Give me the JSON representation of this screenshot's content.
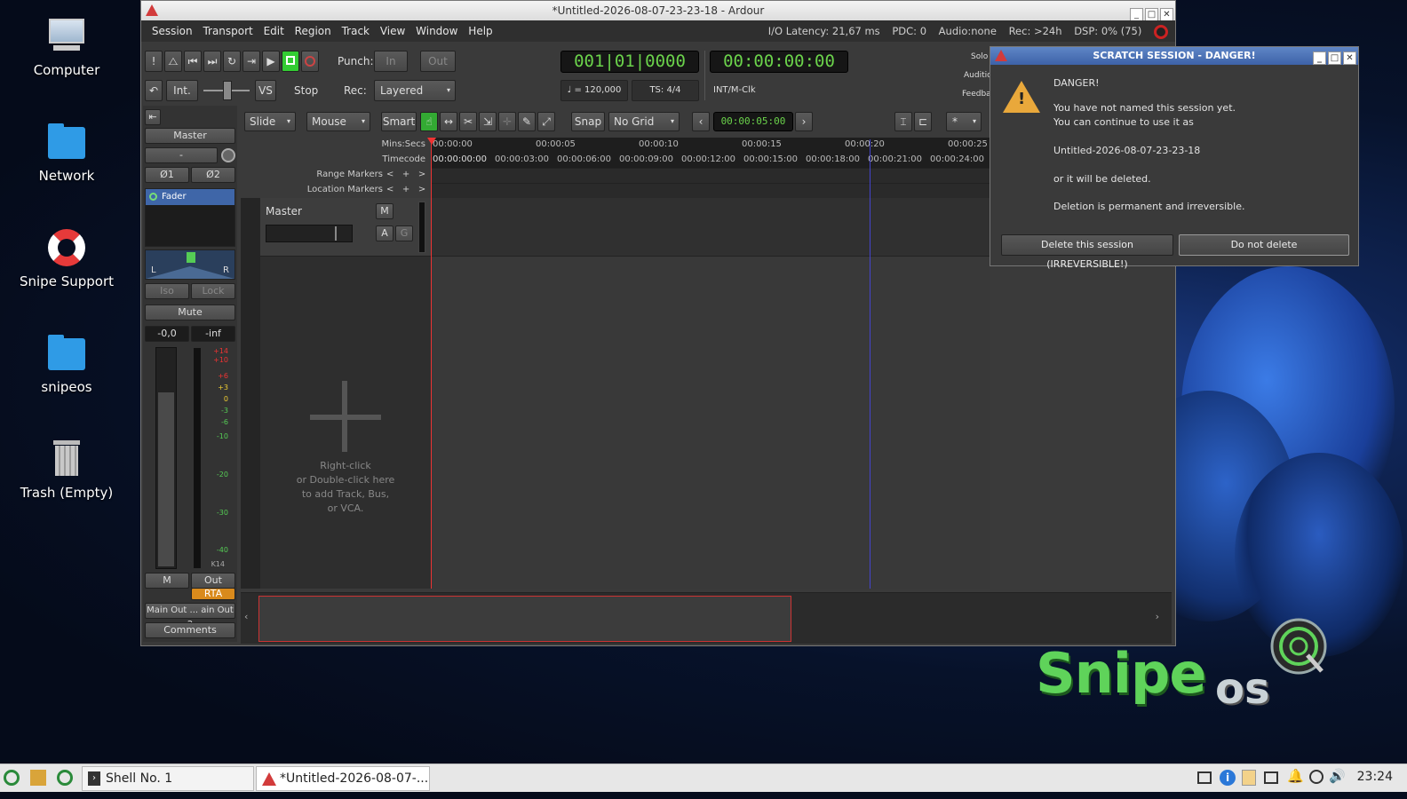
{
  "desktop": {
    "icons": [
      {
        "label": "Computer",
        "icon": "computer-icon"
      },
      {
        "label": "Network",
        "icon": "network-folder-icon"
      },
      {
        "label": "Snipe Support",
        "icon": "lifebuoy-icon"
      },
      {
        "label": "snipeos",
        "icon": "home-folder-icon"
      },
      {
        "label": "Trash (Empty)",
        "icon": "trash-icon"
      }
    ],
    "logo_text_1": "Snipe",
    "logo_text_2": "os"
  },
  "window": {
    "title": "*Untitled-2026-08-07-23-23-18 - Ardour",
    "minimize": "_",
    "maximize": "□",
    "close": "✕"
  },
  "menu": [
    "Session",
    "Transport",
    "Edit",
    "Region",
    "Track",
    "View",
    "Window",
    "Help"
  ],
  "status": {
    "latency": "I/O Latency: 21,67 ms",
    "pdc": "PDC: 0",
    "audio": "Audio:none",
    "rec": "Rec: >24h",
    "dsp": "DSP:  0% (75)"
  },
  "transport": {
    "punch_label": "Punch:",
    "punch_in": "In",
    "punch_out": "Out",
    "int_label": "Int.",
    "vs_label": "VS",
    "stop_label": "Stop",
    "rec_label": "Rec:",
    "rec_mode": "Layered",
    "clock_bbt": "001|01|0000",
    "clock_tc": "00:00:00:00",
    "tempo": "♩ = 120,000",
    "ts": "TS: 4/4",
    "sync": "INT/M-Clk",
    "side_solo": "Solo",
    "side_audition": "Audition",
    "side_feedback": "Feedback"
  },
  "edit_toolbar": {
    "slide": "Slide",
    "mouse": "Mouse",
    "smart": "Smart",
    "snap": "Snap",
    "grid": "No Grid",
    "nudge_clock": "00:00:05:00",
    "star": "*"
  },
  "rulers": {
    "mins_secs_label": "Mins:Secs",
    "timecode_label": "Timecode",
    "range_label": "Range Markers",
    "location_label": "Location Markers",
    "marker_btns": "<   +   >",
    "mins_ticks": [
      "00:00:00",
      "00:00:05",
      "00:00:10",
      "00:00:15",
      "00:00:20",
      "00:00:25"
    ],
    "tc_ticks": [
      "00:00:00:00",
      "00:00:03:00",
      "00:00:06:00",
      "00:00:09:00",
      "00:00:12:00",
      "00:00:15:00",
      "00:00:18:00",
      "00:00:21:00",
      "00:00:24:00"
    ]
  },
  "track": {
    "name": "Master",
    "m": "M",
    "a": "A",
    "g": "G",
    "empty_hint_1": "Right-click",
    "empty_hint_2": "or Double-click here",
    "empty_hint_3": "to add Track, Bus,",
    "empty_hint_4": "or VCA."
  },
  "strip": {
    "name": "Master",
    "input": "-",
    "phase1": "Ø1",
    "phase2": "Ø2",
    "fader": "Fader",
    "pan_l": "L",
    "pan_r": "R",
    "iso": "Iso",
    "lock": "Lock",
    "mute": "Mute",
    "gain": "-0,0",
    "peak": "-inf",
    "meter_ticks": [
      "+14",
      "+10",
      "+6",
      "+3",
      "0",
      "-3",
      "-6",
      "-10",
      "-20",
      "-30",
      "-40"
    ],
    "meter_type": "K14",
    "m": "M",
    "out": "Out",
    "rta": "RTA",
    "output": "Main Out ... ain Out 2",
    "comments": "Comments"
  },
  "dialog": {
    "title": "SCRATCH SESSION - DANGER!",
    "line1": "DANGER!",
    "line2": "You have not named this session yet.",
    "line3": "You can continue to use it as",
    "session_name": "Untitled-2026-08-07-23-23-18",
    "line4": "or it will be deleted.",
    "line5": "Deletion is permanent and irreversible.",
    "delete_btn": "Delete this session (IRREVERSIBLE!)",
    "keep_btn": "Do not delete"
  },
  "taskbar": {
    "task1": "Shell No. 1",
    "task2": "*Untitled-2026-08-07-...",
    "clock": "23:24"
  }
}
